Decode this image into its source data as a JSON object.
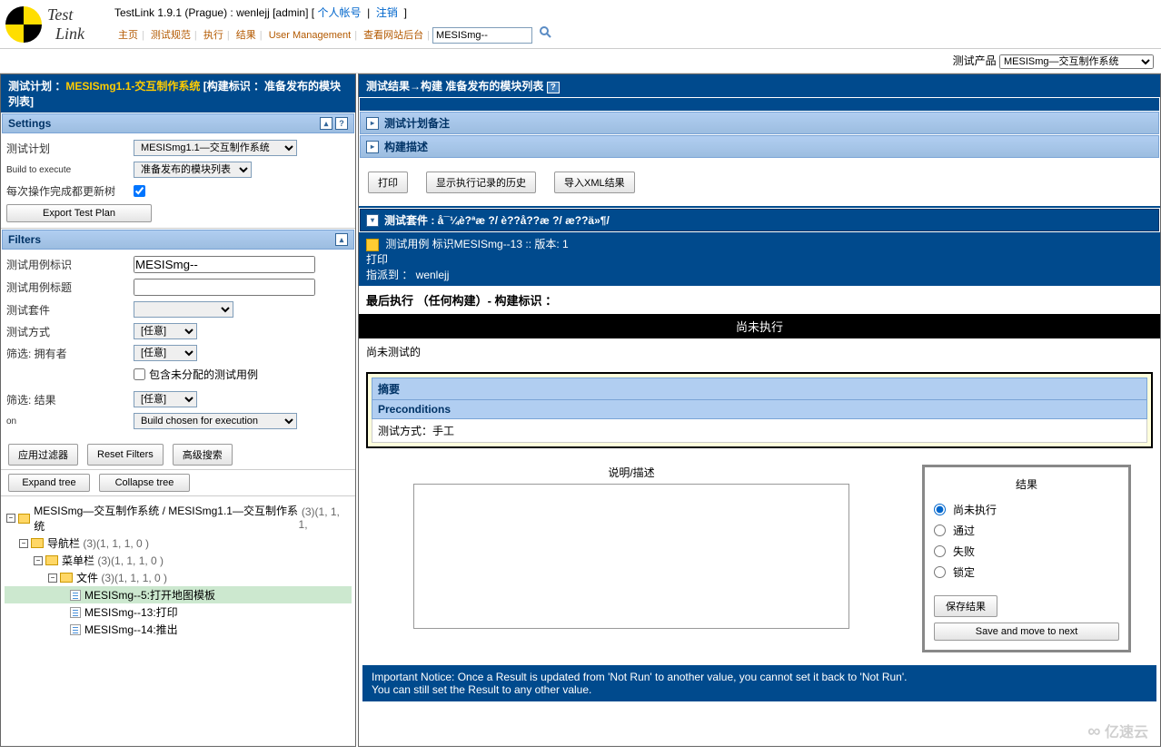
{
  "top": {
    "title_prefix": "TestLink 1.9.1 (Prague) : wenlejj [admin] [ ",
    "account": "个人帐号",
    "logout": "注销",
    "nav": {
      "home": "主页",
      "spec": "测试规范",
      "exec": "执行",
      "result": "结果",
      "um": "User Management",
      "backend": "查看网站后台"
    },
    "search_value": "MESISmg--",
    "product_label": "测试产品",
    "product_value": "MESISmg—交互制作系统"
  },
  "left": {
    "header_a": "测试计划 ：",
    "header_b": "MESISmg1.1-交互制作系统",
    "header_c": "[构建标识 ：准备发布的模块列表]",
    "settings": {
      "title": "Settings",
      "plan_label": "测试计划",
      "plan_value": "MESISmg1.1—交互制作系统",
      "build_label": "Build to execute",
      "build_value": "准备发布的模块列表",
      "refresh_label": "每次操作完成都更新树",
      "export": "Export Test Plan"
    },
    "filters": {
      "title": "Filters",
      "id_label": "测试用例标识",
      "id_value": "MESISmg--",
      "title_label": "测试用例标题",
      "suite_label": "测试套件",
      "method_label": "测试方式",
      "method_value": "[任意]",
      "owner_label": "筛选: 拥有者",
      "owner_value": "[任意]",
      "unassigned": "包含未分配的测试用例",
      "result_label": "筛选: 结果",
      "result_value": "[任意]",
      "on_label": "on",
      "on_value": "Build chosen for execution",
      "apply": "应用过滤器",
      "reset": "Reset Filters",
      "adv": "高级搜索",
      "expand": "Expand tree",
      "collapse": "Collapse tree"
    },
    "tree": {
      "root": "MESISmg—交互制作系统 / MESISmg1.1—交互制作系统",
      "nav": "导航栏",
      "menu": "菜单栏",
      "file": "文件",
      "leaf1": "MESISmg--5:打开地图模板",
      "leaf2": "MESISmg--13:打印",
      "leaf3": "MESISmg--14:推出",
      "c_root": "(3)(1, 1, 1,",
      "c3": "(3)(1, 1, 1, 0 )"
    }
  },
  "right": {
    "header": "测试结果→构建 准备发布的模块列表",
    "plan_notes": "测试计划备注",
    "build_desc": "构建描述",
    "print": "打印",
    "history": "显示执行记录的历史",
    "import": "导入XML结果",
    "suite_title": "测试套件 : å¯¼è?ªæ ?/ è??å??æ ?/ æ??ä»¶/",
    "tc_title": "测试用例 标识MESISmg--13 :: 版本: 1",
    "tc_print": "打印",
    "assign": "指派到 ： wenlejj",
    "last_exec": "最后执行 （任何构建）- 构建标识 ：",
    "not_run": "尚未执行",
    "not_tested": "尚未测试的",
    "summary": "摘要",
    "precond": "Preconditions",
    "method": "测试方式：手工",
    "desc_label": "说明/描述",
    "result_title": "结果",
    "r_notrun": "尚未执行",
    "r_pass": "通过",
    "r_fail": "失败",
    "r_block": "锁定",
    "save": "保存结果",
    "savenext": "Save and move to next",
    "notice1": "Important Notice: Once a Result is updated from 'Not Run' to another value, you cannot set it back to 'Not Run'.",
    "notice2": "You can still set the Result to any other value."
  },
  "watermark": "亿速云"
}
